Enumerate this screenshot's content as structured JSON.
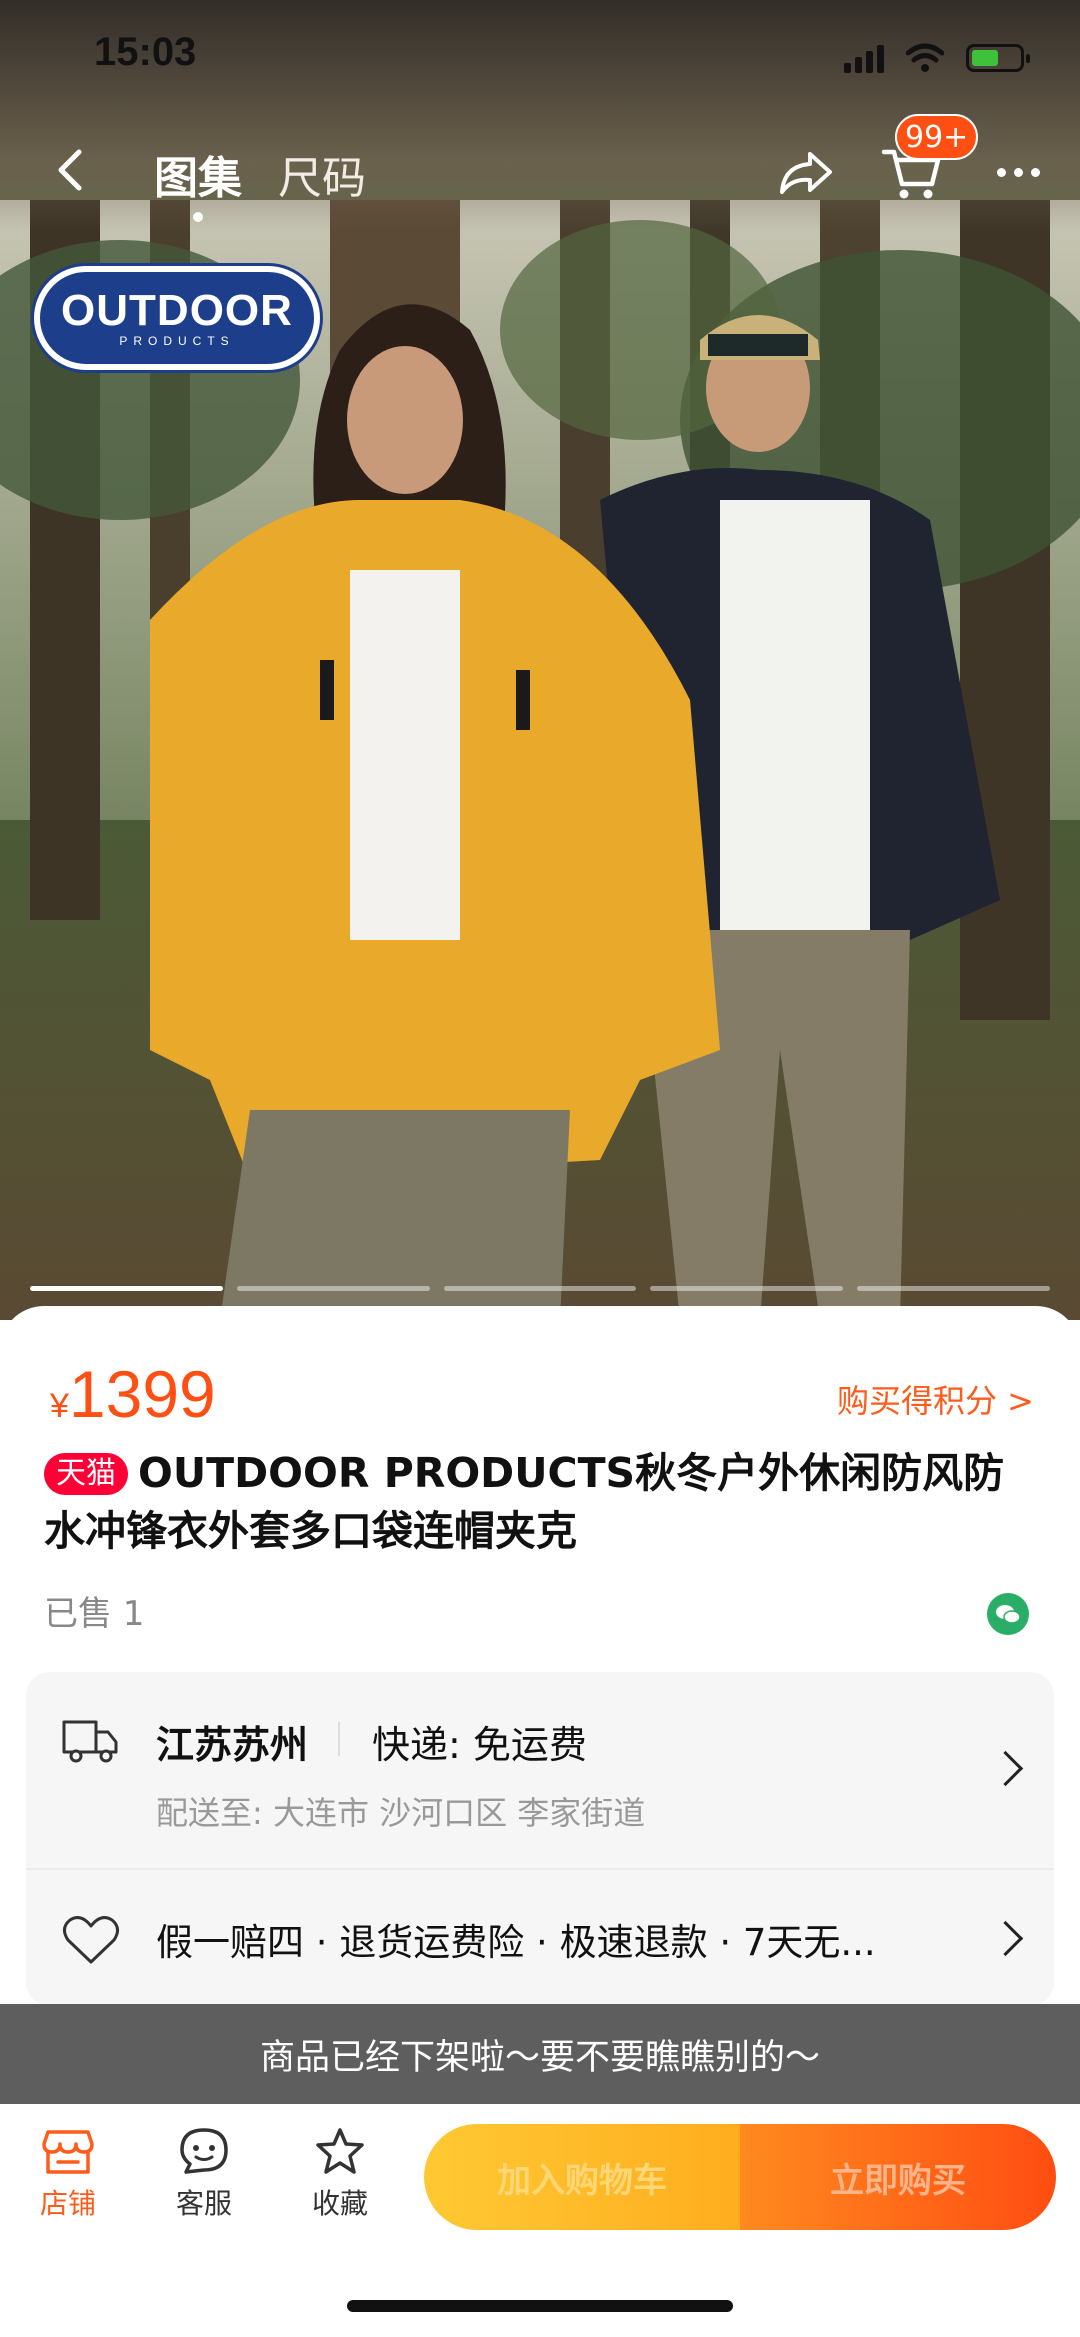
{
  "status_bar": {
    "time": "15:03"
  },
  "nav": {
    "tabs": [
      {
        "label": "图集",
        "active": true
      },
      {
        "label": "尺码",
        "active": false
      }
    ],
    "cart_badge": "99+"
  },
  "hero": {
    "brand_logo_text": "OUTDOOR",
    "brand_logo_sub": "PRODUCTS",
    "carousel_pages": 5,
    "carousel_active": 1
  },
  "product": {
    "currency": "¥",
    "price": "1399",
    "points_link": "购买得积分 >",
    "store_badge": "天猫",
    "title": "OUTDOOR PRODUCTS秋冬户外休闲防风防水冲锋衣外套多口袋连帽夹克",
    "sold": "已售 1"
  },
  "delivery": {
    "origin": "江苏苏州",
    "shipping": "快递: 免运费",
    "destination": "配送至: 大连市 沙河口区 李家街道"
  },
  "services": {
    "text": "假一赔四 · 退货运费险 · 极速退款 · 7天无..."
  },
  "offline_notice": "商品已经下架啦～要不要瞧瞧别的～",
  "bottom_bar": {
    "store": "店铺",
    "service": "客服",
    "favorite": "收藏",
    "add_to_cart": "加入购物车",
    "buy_now": "立即购买"
  },
  "colors": {
    "accent": "#ff5b1a",
    "price": "#ff4f12",
    "tmall": "#ff0036",
    "banner": "#5e5e5e"
  }
}
